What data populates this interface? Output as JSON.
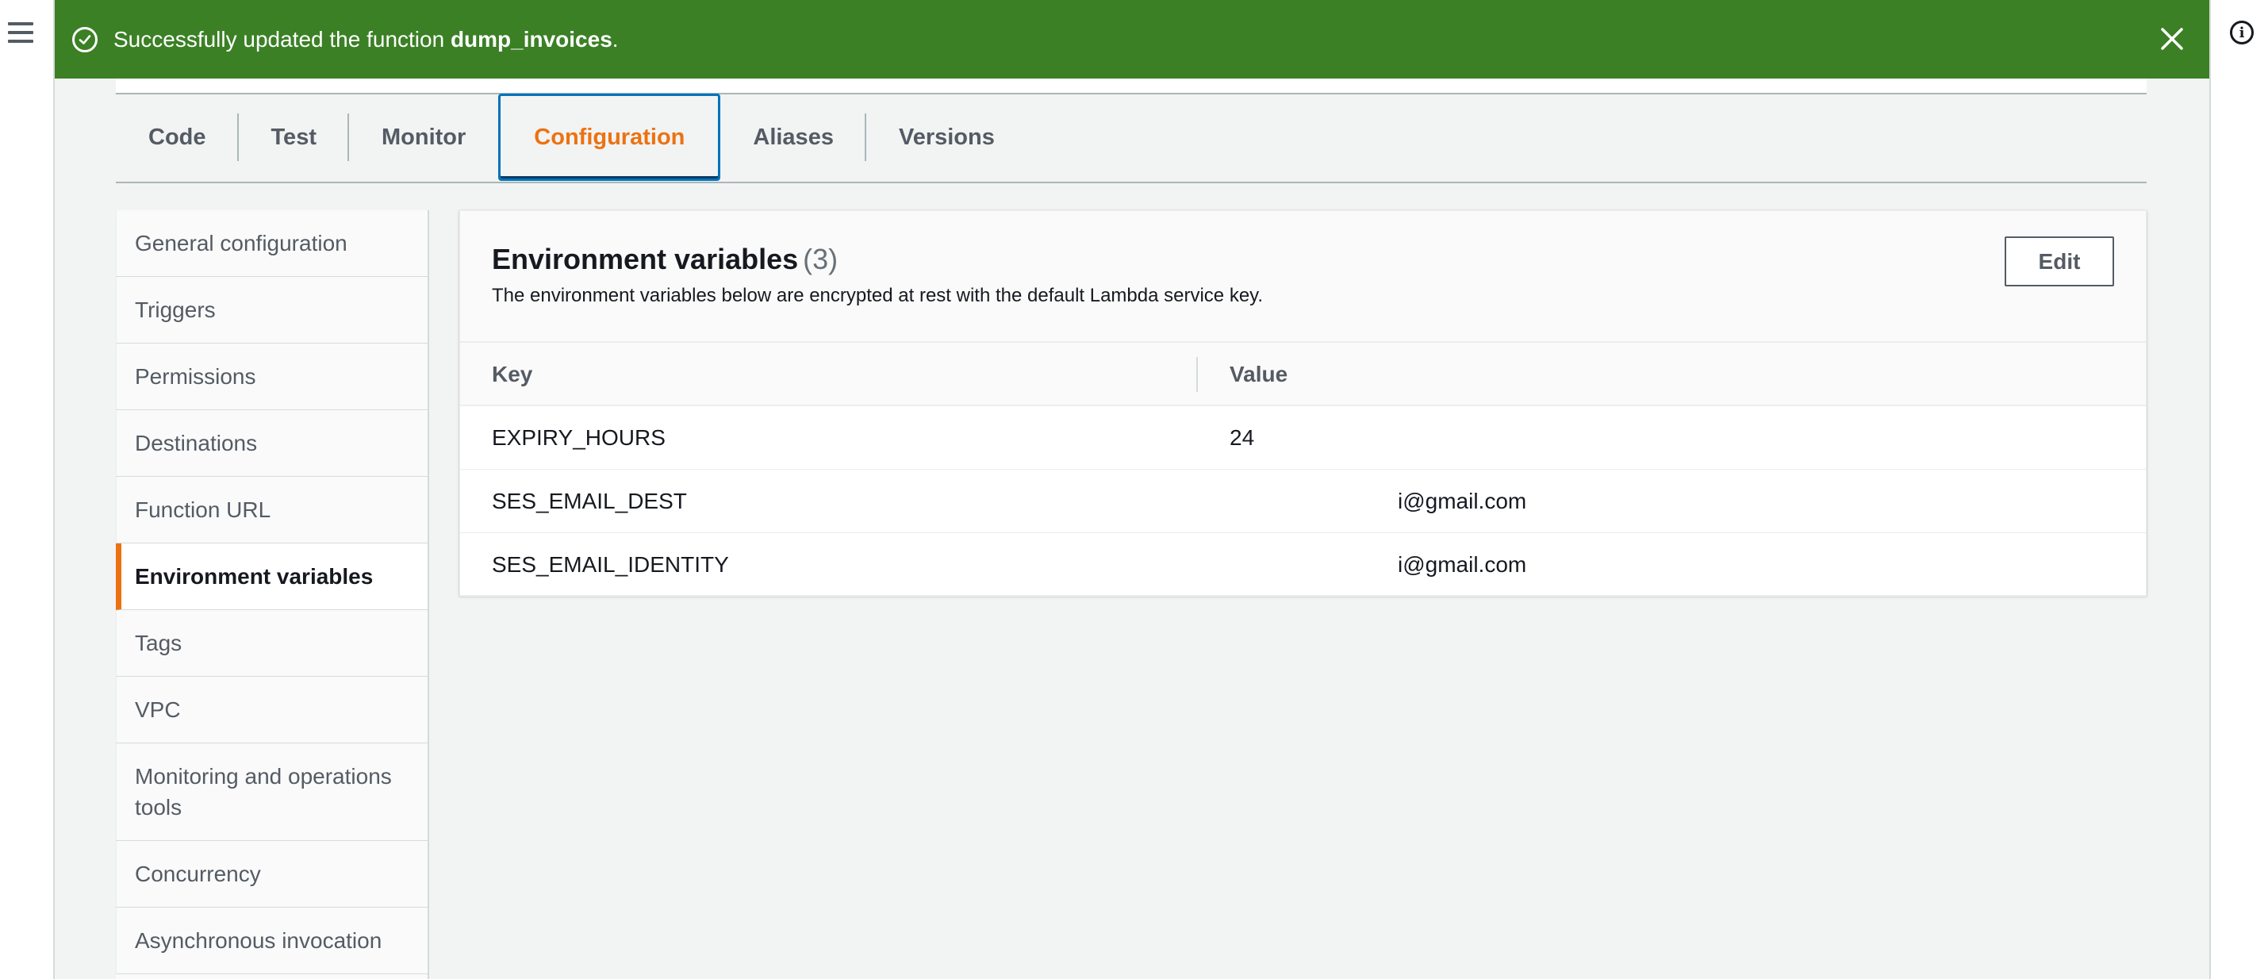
{
  "flash": {
    "prefix": "Successfully updated the function ",
    "function_name": "dump_invoices",
    "suffix": ".",
    "color": "#3b8025"
  },
  "icons": {
    "menu": "hamburger-menu-icon",
    "info": "info-icon",
    "success": "check-circle-icon",
    "close": "close-icon"
  },
  "tabs": [
    {
      "label": "Code"
    },
    {
      "label": "Test"
    },
    {
      "label": "Monitor"
    },
    {
      "label": "Configuration",
      "active": true
    },
    {
      "label": "Aliases"
    },
    {
      "label": "Versions"
    }
  ],
  "sidebar": {
    "items": [
      {
        "label": "General configuration"
      },
      {
        "label": "Triggers"
      },
      {
        "label": "Permissions"
      },
      {
        "label": "Destinations"
      },
      {
        "label": "Function URL"
      },
      {
        "label": "Environment variables",
        "active": true
      },
      {
        "label": "Tags"
      },
      {
        "label": "VPC"
      },
      {
        "label": "Monitoring and operations tools"
      },
      {
        "label": "Concurrency"
      },
      {
        "label": "Asynchronous invocation"
      }
    ]
  },
  "env": {
    "title": "Environment variables",
    "count": "(3)",
    "description": "The environment variables below are encrypted at rest with the default Lambda service key.",
    "edit_label": "Edit",
    "columns": {
      "key": "Key",
      "value": "Value"
    },
    "rows": [
      {
        "key": "EXPIRY_HOURS",
        "value": "24"
      },
      {
        "key": "SES_EMAIL_DEST",
        "value": "i@gmail.com"
      },
      {
        "key": "SES_EMAIL_IDENTITY",
        "value": "i@gmail.com"
      }
    ]
  },
  "colors": {
    "accent": "#ec7211",
    "tab_focus": "#0073bb"
  }
}
